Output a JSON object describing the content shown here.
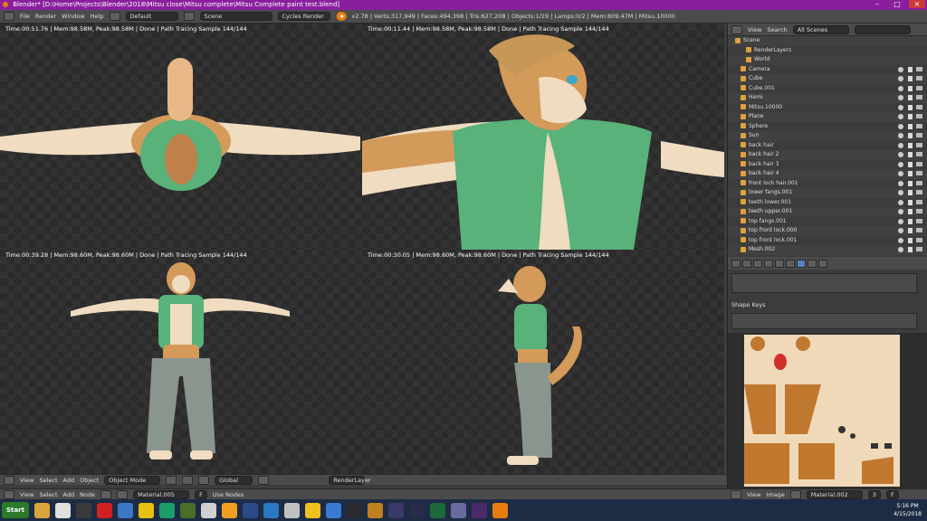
{
  "window": {
    "title": "Blender* [D:\\Home\\Projects\\Blender\\2018\\Mitsu close\\Mitsu complete\\Mitsu Complete paint test.blend]"
  },
  "info_header": {
    "menus": [
      "File",
      "Render",
      "Window",
      "Help"
    ],
    "layout": "Default",
    "scene": "Scene",
    "engine": "Cycles Render",
    "stats": "v2.78 | Verts:317,949 | Faces:494,398 | Tris:627,208 | Objects:1/19 | Lamps:0/2 | Mem:809.47M | Mitsu.10000"
  },
  "viewports": [
    {
      "info": "Time:00:51.76 | Mem:98.58M, Peak:98.58M | Done | Path Tracing Sample 144/144"
    },
    {
      "info": "Time:00:11.44 | Mem:98.58M, Peak:98.58M | Done | Path Tracing Sample 144/144"
    },
    {
      "info": "Time:00:39.28 | Mem:98.60M, Peak:98.60M | Done | Path Tracing Sample 144/144"
    },
    {
      "info": "Time:00:30.05 | Mem:98.60M, Peak:98.60M | Done | Path Tracing Sample 144/144"
    }
  ],
  "view3d_header": {
    "menus": [
      "View",
      "Select",
      "Add",
      "Object"
    ],
    "mode": "Object Mode",
    "orientation": "Global",
    "render_layer": "RenderLayer"
  },
  "node_header": {
    "menus": [
      "View",
      "Select",
      "Add",
      "Node"
    ],
    "material": "Material.005",
    "f_label": "F",
    "use_nodes": "Use Nodes"
  },
  "outliner": {
    "menus": [
      "View",
      "Search"
    ],
    "filter": "All Scenes",
    "items": [
      {
        "label": "Scene"
      },
      {
        "label": "RenderLayers"
      },
      {
        "label": "World"
      },
      {
        "label": "Camera"
      },
      {
        "label": "Cube"
      },
      {
        "label": "Cube.001"
      },
      {
        "label": "Hemi"
      },
      {
        "label": "Mitsu.10000"
      },
      {
        "label": "Plane"
      },
      {
        "label": "Sphere"
      },
      {
        "label": "Sun"
      },
      {
        "label": "back hair"
      },
      {
        "label": "back hair 2"
      },
      {
        "label": "back hair 3"
      },
      {
        "label": "back hair 4"
      },
      {
        "label": "front lock hair.001"
      },
      {
        "label": "lower fangs.001"
      },
      {
        "label": "teeth lower.001"
      },
      {
        "label": "teeth upper.001"
      },
      {
        "label": "top fangs.001"
      },
      {
        "label": "top front lock.000"
      },
      {
        "label": "top front lock.001"
      },
      {
        "label": "Mesh.002"
      }
    ]
  },
  "properties": {
    "shape_keys_label": "Shape Keys"
  },
  "uv_header": {
    "menus": [
      "View",
      "Image"
    ],
    "image": "Material.002 Diffus...",
    "slot": "3",
    "f_label": "F"
  },
  "taskbar": {
    "start": "Start",
    "time": "5:16 PM",
    "date": "4/15/2018"
  }
}
